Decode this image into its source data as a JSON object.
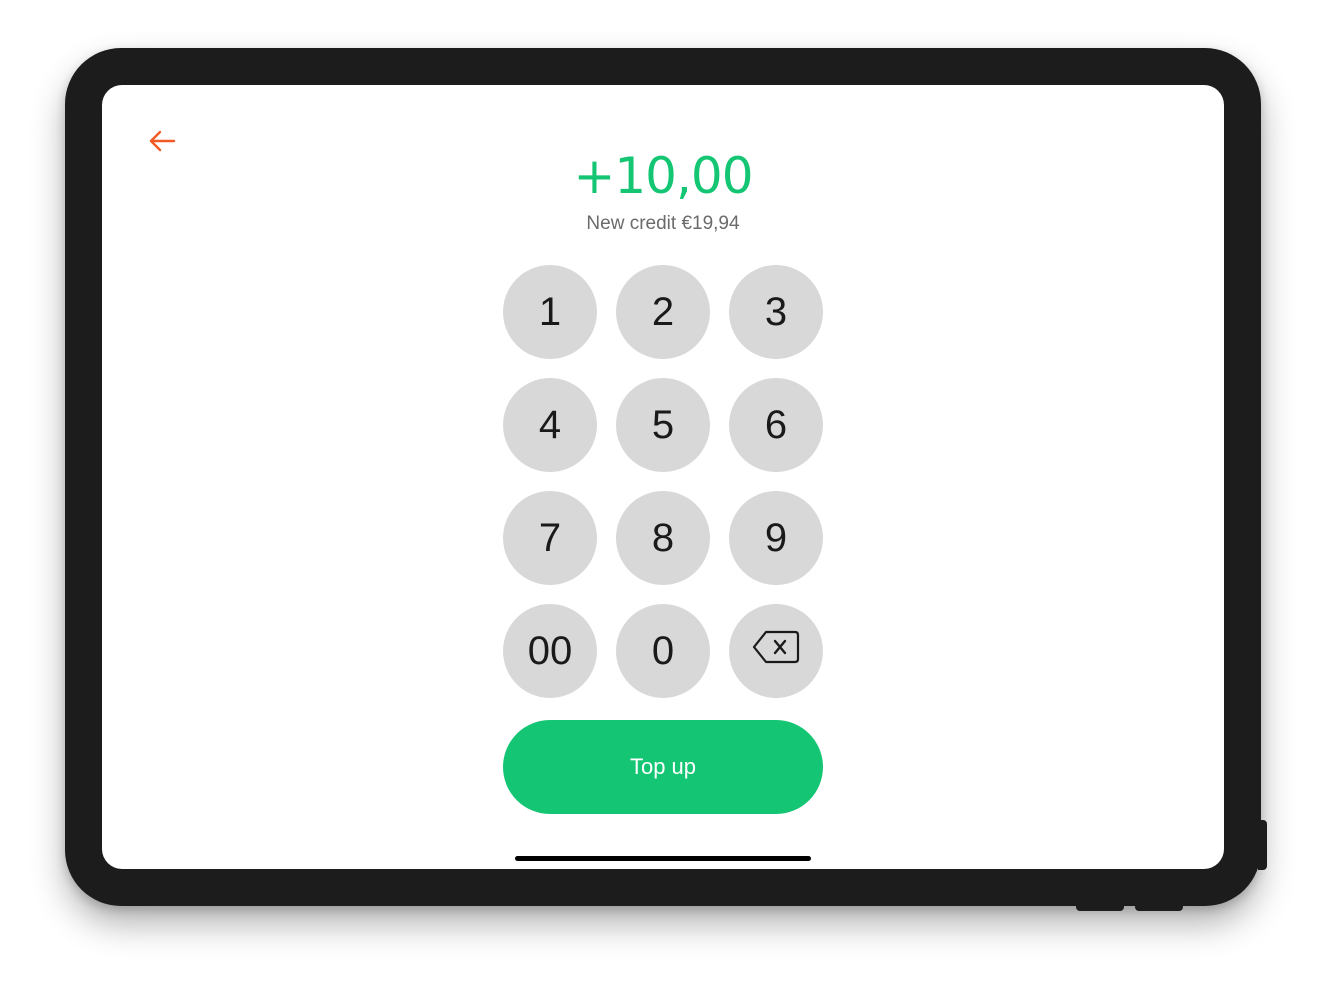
{
  "amount": {
    "display": "+10,00"
  },
  "credit": {
    "label": "New credit €19,94"
  },
  "keypad": {
    "keys": [
      "1",
      "2",
      "3",
      "4",
      "5",
      "6",
      "7",
      "8",
      "9",
      "00",
      "0"
    ],
    "backspace_icon": "backspace-icon"
  },
  "action": {
    "top_up_label": "Top up"
  },
  "icons": {
    "back": "arrow-left-icon"
  },
  "colors": {
    "accent_green": "#14c674",
    "back_arrow": "#f15a24",
    "key_bg": "#d8d8d8",
    "key_text": "#1a1a1a",
    "subtitle_text": "#6b6b6b",
    "frame": "#1c1c1c"
  }
}
